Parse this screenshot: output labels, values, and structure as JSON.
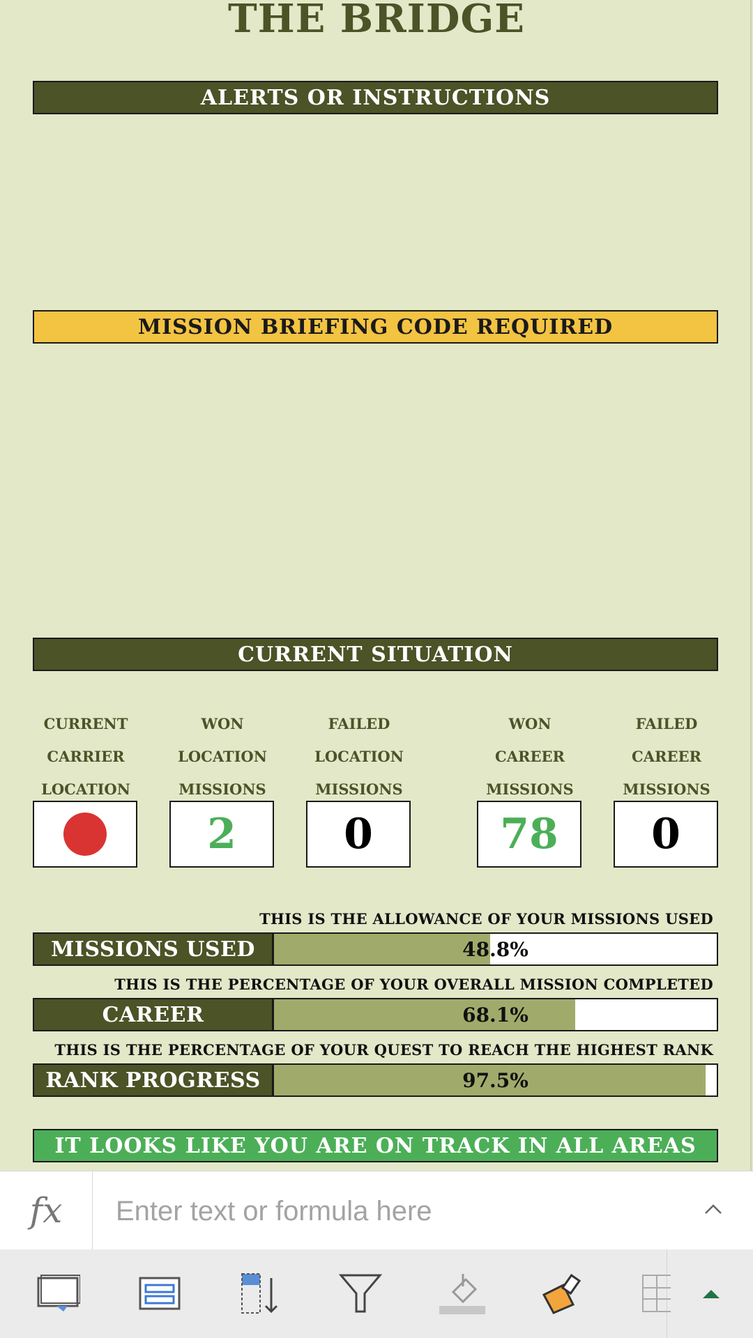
{
  "title": "THE BRIDGE",
  "sections": {
    "alerts": "ALERTS OR INSTRUCTIONS",
    "briefing": "MISSION BRIEFING CODE REQUIRED",
    "situation": "CURRENT SITUATION"
  },
  "stats": [
    {
      "label": [
        "CURRENT",
        "CARRIER",
        "LOCATION"
      ],
      "value": "",
      "icon": "red-dot-icon",
      "color": "#d93431"
    },
    {
      "label": [
        "WON",
        "LOCATION",
        "MISSIONS"
      ],
      "value": "2",
      "color": "#4caf58"
    },
    {
      "label": [
        "FAILED",
        "LOCATION",
        "MISSIONS"
      ],
      "value": "0",
      "color": "#000000"
    },
    {
      "label": [
        "WON",
        "CAREER",
        "MISSIONS"
      ],
      "value": "78",
      "color": "#4caf58"
    },
    {
      "label": [
        "FAILED",
        "CAREER",
        "MISSIONS"
      ],
      "value": "0",
      "color": "#000000"
    }
  ],
  "progress": [
    {
      "note": "THIS IS THE ALLOWANCE OF YOUR MISSIONS USED",
      "label": "MISSIONS USED",
      "value": "48.8%",
      "fraction": 0.488
    },
    {
      "note": "THIS IS THE PERCENTAGE OF YOUR OVERALL MISSION COMPLETED",
      "label": "CAREER",
      "value": "68.1%",
      "fraction": 0.681
    },
    {
      "note": "THIS IS THE PERCENTAGE OF YOUR QUEST TO REACH THE HIGHEST RANK",
      "label": "RANK PROGRESS",
      "value": "97.5%",
      "fraction": 0.975
    }
  ],
  "status": "IT LOOKS LIKE YOU ARE ON TRACK IN ALL AREAS",
  "formula_bar": {
    "fx_label": "fx",
    "placeholder": "Enter text or formula here"
  },
  "colors": {
    "olive": "#4b5327",
    "background": "#e2e8c8",
    "yellow": "#f3c342",
    "green": "#4caf58",
    "progress_fill": "#a0ab6b"
  },
  "toolbar": {
    "tools": [
      "insert-comment-icon",
      "freeze-panes-icon",
      "sort-icon",
      "filter-icon",
      "fill-color-icon",
      "format-painter-icon",
      "table-icon",
      "expand-toolbar-icon"
    ]
  }
}
